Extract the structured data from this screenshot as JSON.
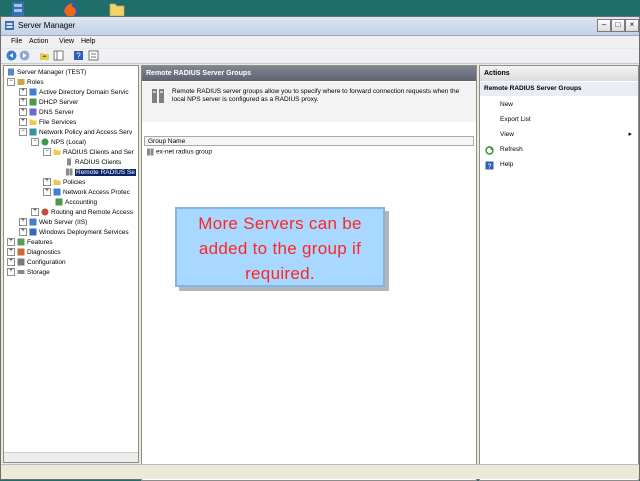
{
  "window": {
    "title": "Server Manager"
  },
  "menu": [
    "File",
    "Action",
    "View",
    "Help"
  ],
  "tree": {
    "items": [
      "Server Manager (TEST)",
      "Roles",
      "Active Directory Domain Servic",
      "DHCP Server",
      "DNS Server",
      "File Services",
      "Network Policy and Access Serv",
      "NPS (Local)",
      "RADIUS Clients and Ser",
      "RADIUS Clients",
      "Remote RADIUS Se",
      "Policies",
      "Network Access Protec",
      "Accounting",
      "Routing and Remote Access",
      "Web Server (IIS)",
      "Windows Deployment Services",
      "Features",
      "Diagnostics",
      "Configuration",
      "Storage"
    ]
  },
  "center": {
    "title": "Remote RADIUS Server Groups",
    "description": "Remote RADIUS server groups allow you to specify where to forward connection requests when the local NPS server is configured as a RADIUS proxy.",
    "column_header": "Group Name",
    "rows": [
      "ex-net radius group"
    ]
  },
  "actions": {
    "header": "Actions",
    "section": "Remote RADIUS Server Groups",
    "items": [
      "New",
      "Export List",
      "View",
      "Refresh",
      "Help"
    ]
  },
  "callout": {
    "text": "More Servers can be added to the group if required."
  },
  "colors": {
    "selection": "#0a246a",
    "callout_bg": "#a8d8ff",
    "callout_text": "#ff2525"
  }
}
